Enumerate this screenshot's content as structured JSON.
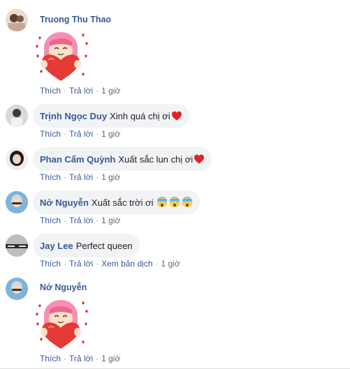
{
  "comments": [
    {
      "author": "Truong Thu Thao",
      "sticker": "heart-hug-sticker",
      "actions": {
        "like": "Thích",
        "reply": "Trả lời",
        "time": "1 giờ"
      }
    },
    {
      "author": "Trịnh Ngọc Duy",
      "text": "Xinh quá chị ơi",
      "emoji": [
        "red-heart"
      ],
      "actions": {
        "like": "Thích",
        "reply": "Trả lời",
        "time": "1 giờ"
      }
    },
    {
      "author": "Phan Cẩm Quỳnh",
      "text": "Xuất sắc lun chị ơi",
      "emoji": [
        "red-heart"
      ],
      "actions": {
        "like": "Thích",
        "reply": "Trả lời",
        "time": "1 giờ"
      }
    },
    {
      "author": "Nở Nguyễn",
      "text": "Xuất sắc trời ơi",
      "emoji": [
        "screaming-face",
        "screaming-face",
        "screaming-face"
      ],
      "actions": {
        "like": "Thích",
        "reply": "Trả lời",
        "time": "1 giờ"
      }
    },
    {
      "author": "Jay Lee",
      "text": "Perfect queen",
      "actions": {
        "like": "Thích",
        "reply": "Trả lời",
        "translate": "Xem bản dịch",
        "time": "1 giờ"
      }
    },
    {
      "author": "Nở Nguyễn",
      "sticker": "heart-hug-sticker",
      "actions": {
        "like": "Thích",
        "reply": "Trả lời",
        "time": "1 giờ"
      }
    }
  ],
  "colors": {
    "link": "#385898",
    "bubble": "#f2f3f5",
    "meta": "#606770",
    "heart": "#e0242a"
  }
}
